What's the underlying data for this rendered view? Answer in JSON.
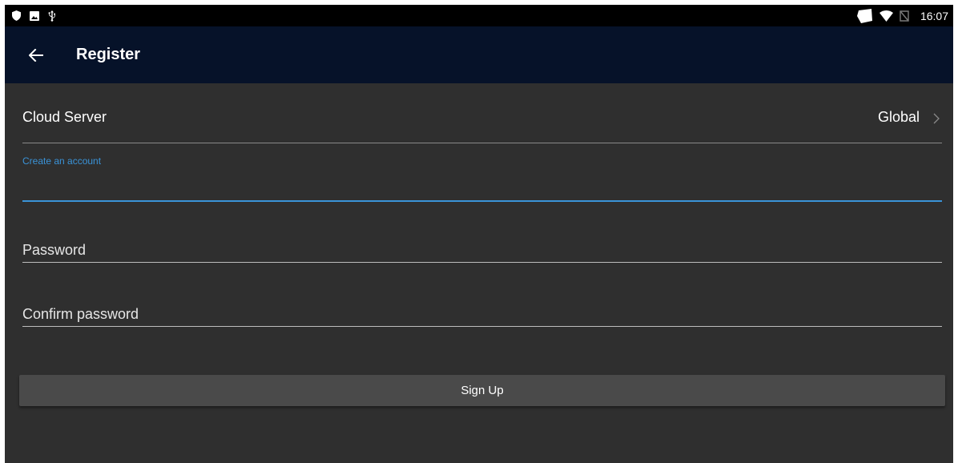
{
  "status_bar": {
    "time": "16:07",
    "left_icons": [
      "shield-icon",
      "image-icon",
      "usb-icon"
    ],
    "right_icons": [
      "notification-icon",
      "wifi-icon",
      "no-sim-icon"
    ]
  },
  "app_bar": {
    "back_icon": "arrow-left-icon",
    "title": "Register",
    "background": "#061229"
  },
  "cloud_server": {
    "label": "Cloud Server",
    "value": "Global",
    "chevron_icon": "chevron-right-icon"
  },
  "form": {
    "account": {
      "floating_label": "Create an account",
      "value": "",
      "accent": "#3a93d8"
    },
    "password": {
      "placeholder": "Password",
      "value": ""
    },
    "confirm_password": {
      "placeholder": "Confirm password",
      "value": ""
    },
    "submit_label": "Sign Up"
  },
  "colors": {
    "background": "#2f2f2f",
    "accent": "#3a93d8",
    "button": "#4a4a4a"
  }
}
